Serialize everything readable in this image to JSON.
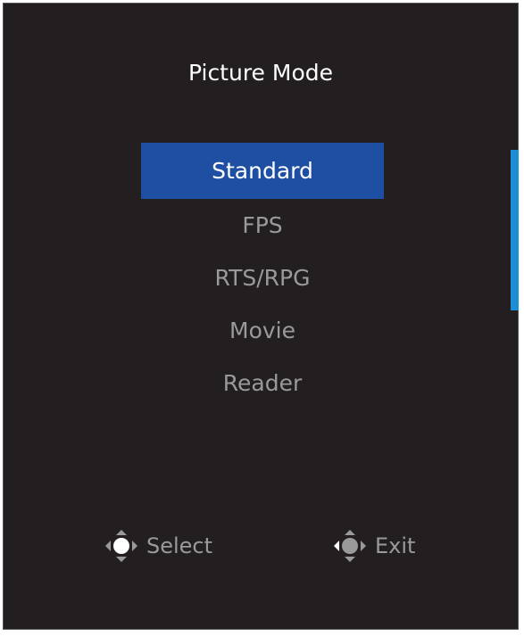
{
  "title": "Picture Mode",
  "menu": {
    "items": [
      {
        "label": "Standard",
        "selected": true
      },
      {
        "label": "FPS",
        "selected": false
      },
      {
        "label": "RTS/RPG",
        "selected": false
      },
      {
        "label": "Movie",
        "selected": false
      },
      {
        "label": "Reader",
        "selected": false
      }
    ]
  },
  "hints": {
    "select": {
      "label": "Select",
      "icon": "joystick-press-icon"
    },
    "exit": {
      "label": "Exit",
      "icon": "joystick-left-icon"
    }
  },
  "colors": {
    "background": "#231f20",
    "selected": "#1f4fa3",
    "scrollbar": "#1b8ed6",
    "text_dim": "#9a9a9a"
  }
}
